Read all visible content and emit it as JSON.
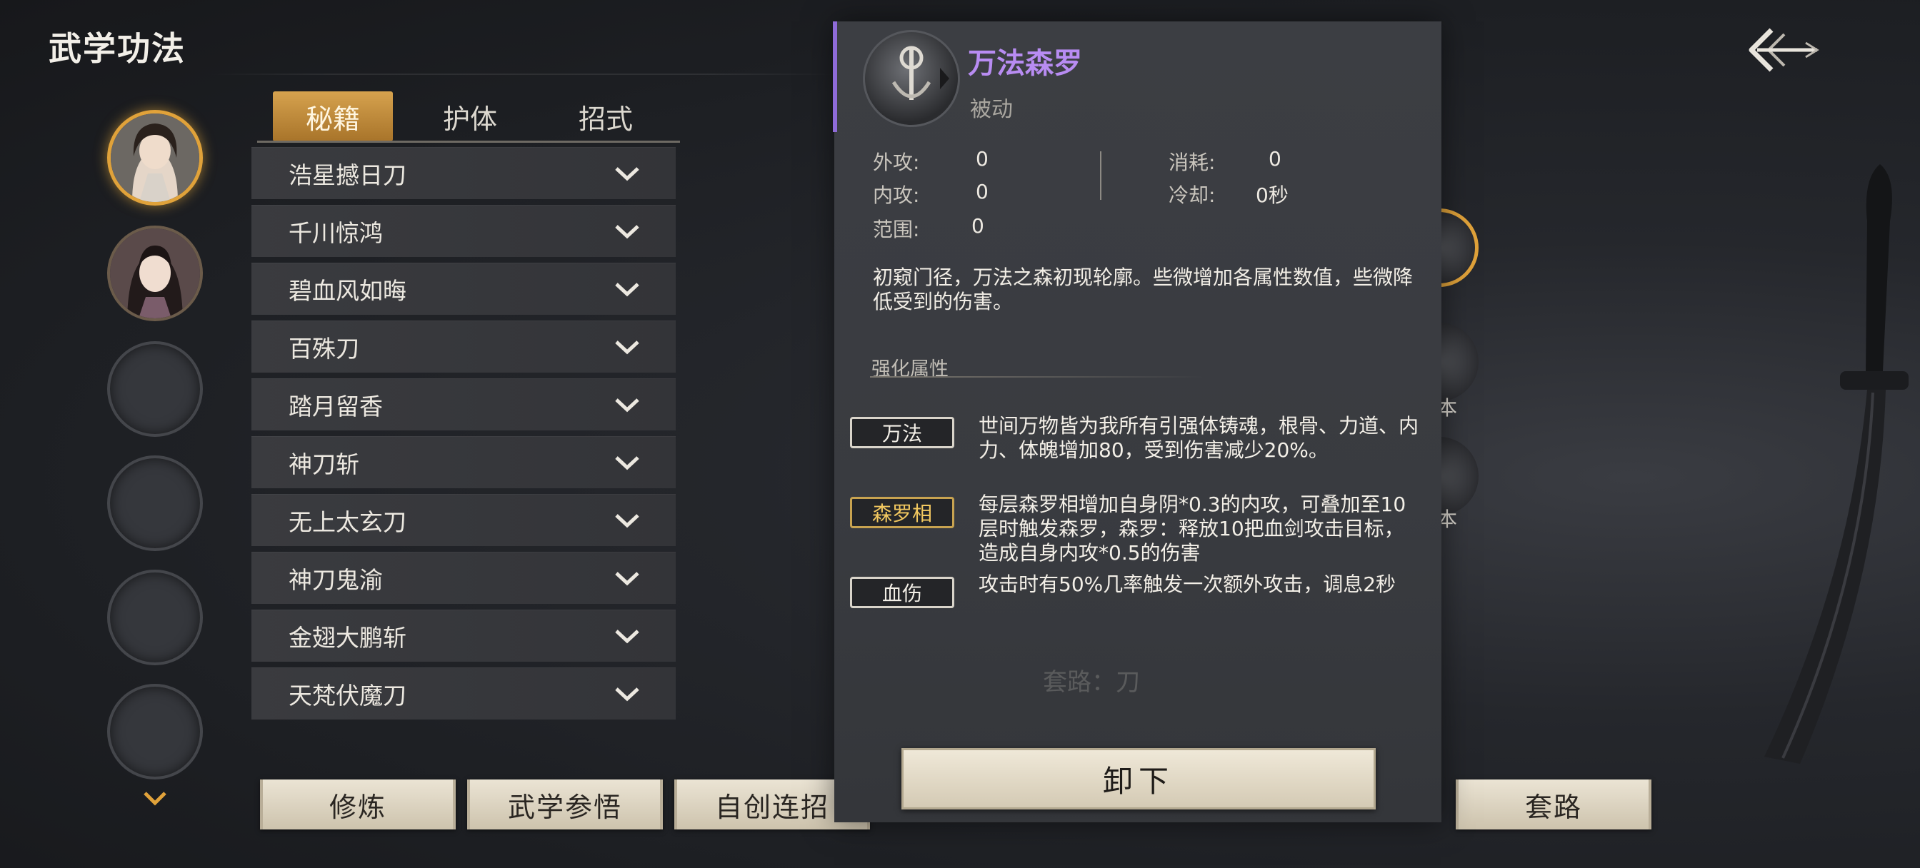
{
  "header": {
    "title": "武学功法",
    "back_icon": "back-arrow-icon"
  },
  "tabs": [
    {
      "label": "秘籍",
      "active": true
    },
    {
      "label": "护体",
      "active": false
    },
    {
      "label": "招式",
      "active": false
    }
  ],
  "skills": [
    "浩星撼日刀",
    "千川惊鸿",
    "碧血风如晦",
    "百殊刀",
    "踏月留香",
    "神刀斩",
    "无上太玄刀",
    "神刀鬼渝",
    "金翅大鹏斩",
    "天梵伏魔刀"
  ],
  "bottom_buttons": {
    "cultivate": "修炼",
    "insight": "武学参悟",
    "combo": "自创连招",
    "route": "套路"
  },
  "detail": {
    "name": "万法森罗",
    "type": "被动",
    "stats": {
      "outer_atk_label": "外攻:",
      "outer_atk": "0",
      "inner_atk_label": "内攻:",
      "inner_atk": "0",
      "range_label": "范围:",
      "range": "0",
      "cost_label": "消耗:",
      "cost": "0",
      "cooldown_label": "冷却:",
      "cooldown": "0秒"
    },
    "description": "初窥门径，万法之森初现轮廓。些微增加各属性数值，些微降低受到的伤害。",
    "enhance_title": "强化属性",
    "effects": [
      {
        "tag": "万法",
        "text": "世间万物皆为我所有引强体铸魂，根骨、力道、内力、体魄增加80，受到伤害减少20%。"
      },
      {
        "tag": "森罗相",
        "text": "每层森罗相增加自身阴*0.3的内攻，可叠加至10层时触发森罗，森罗：释放10把血剑攻击目标，造成自身内攻*0.5的伤害"
      },
      {
        "tag": "血伤",
        "text": "攻击时有50%几率触发一次额外攻击，调息2秒"
      }
    ],
    "route_ghost": "套路：刀",
    "unequip": "卸下"
  },
  "side_labels": [
    "本",
    "本"
  ],
  "colors": {
    "accent_gold": "#e0a23a",
    "skill_name_purple": "#b88cf2",
    "panel_accent": "#8f6bd8"
  }
}
